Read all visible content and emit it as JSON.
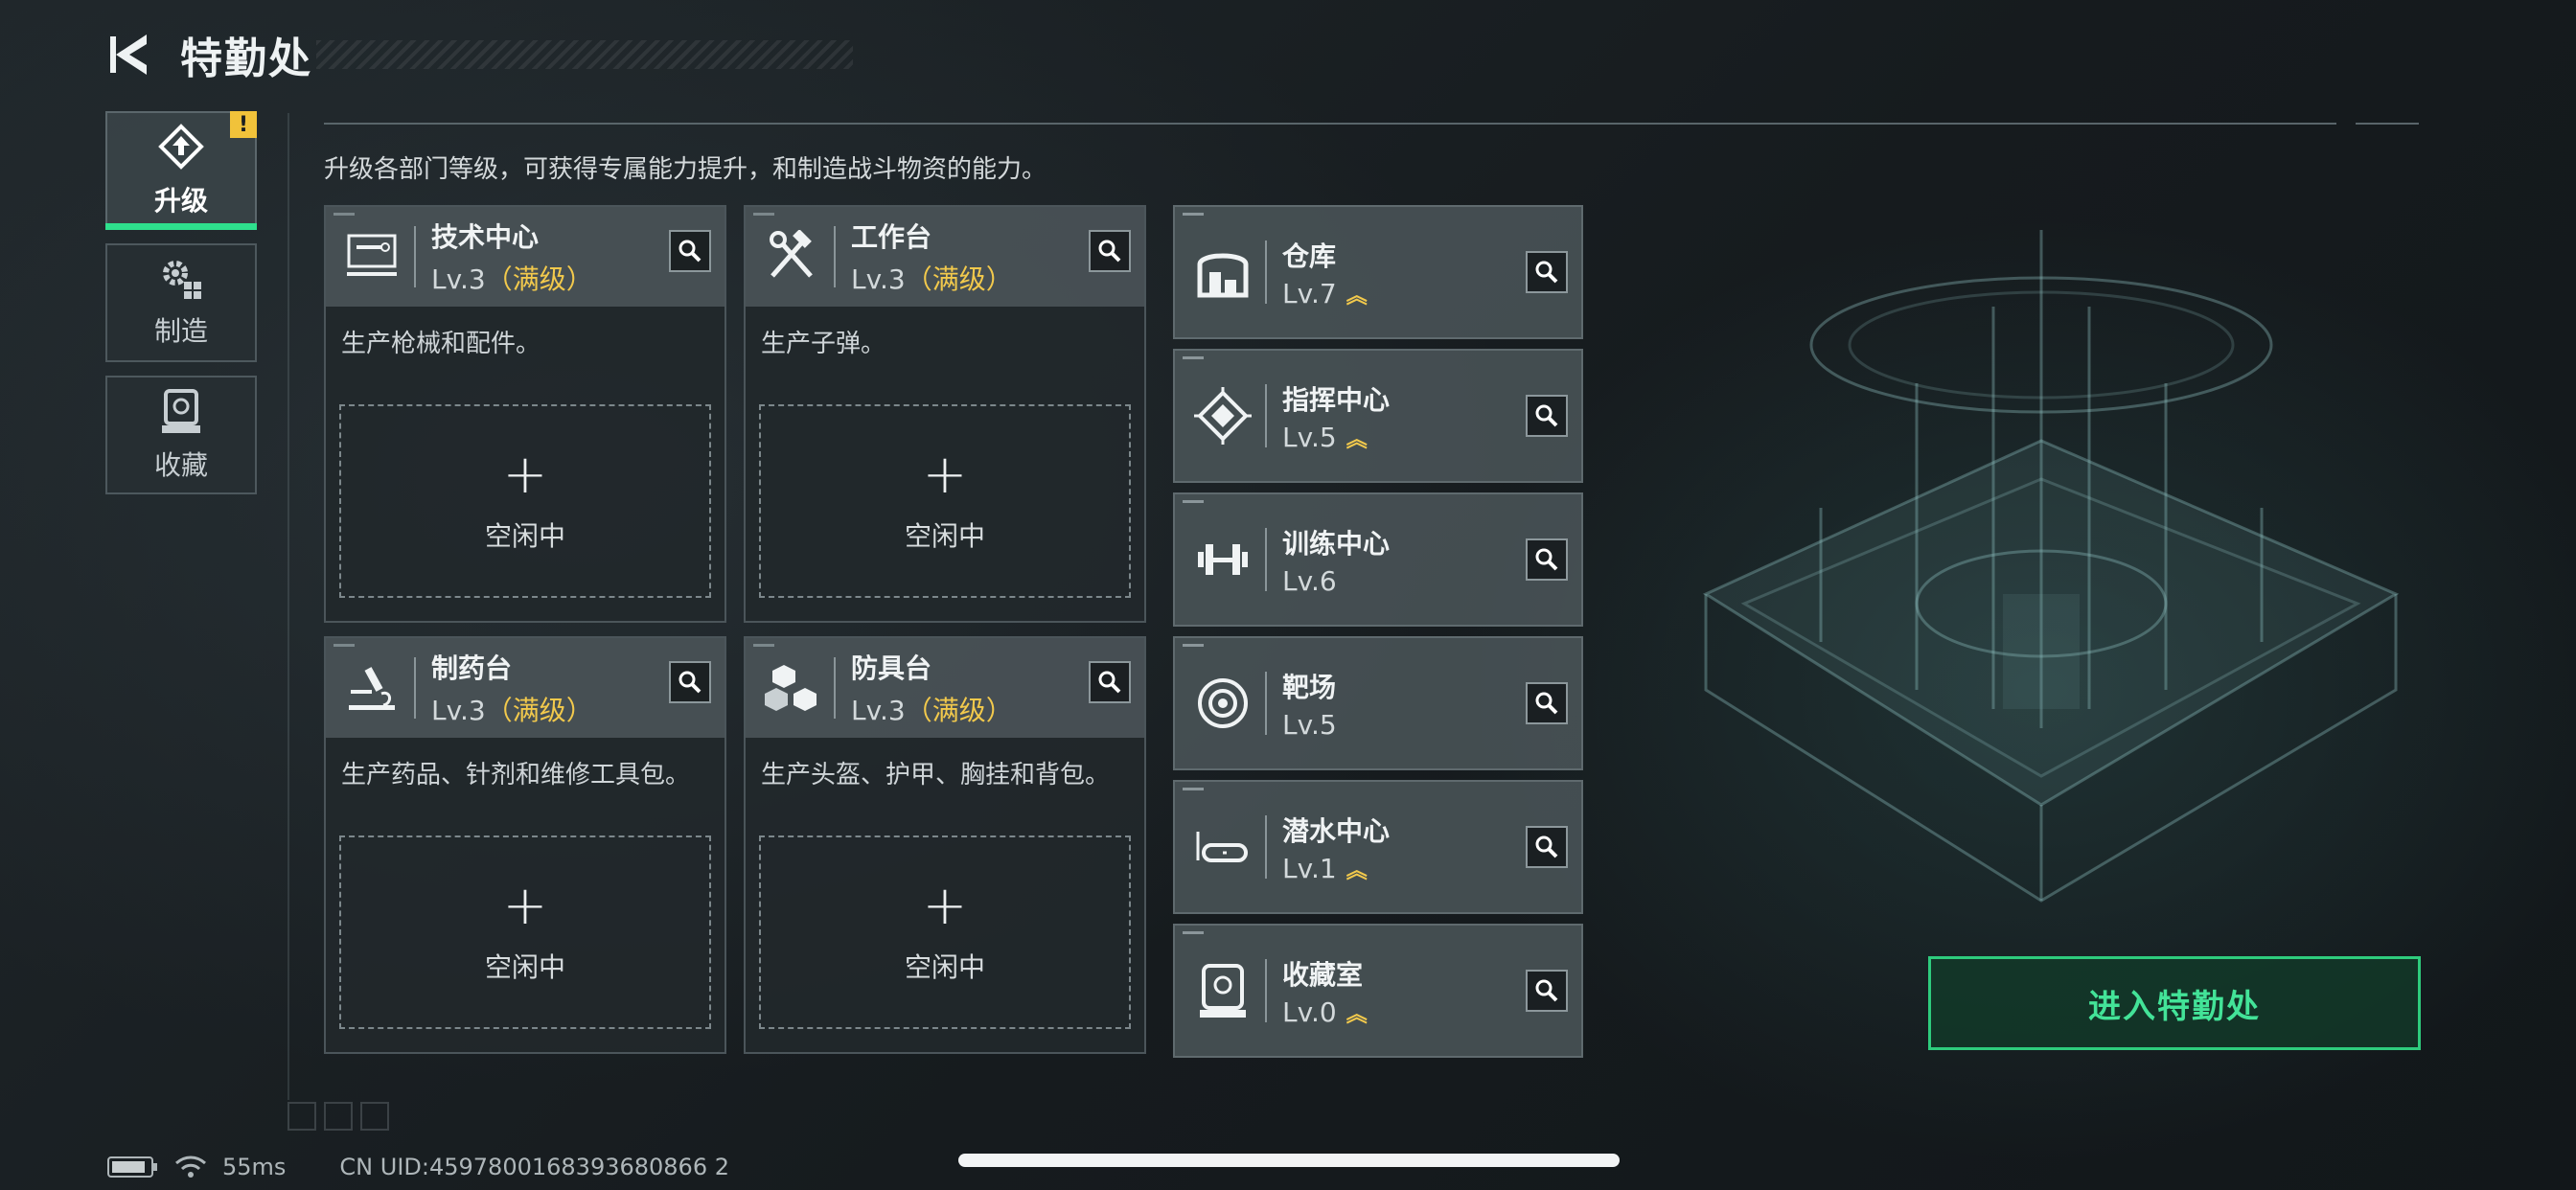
{
  "header": {
    "title": "特勤处"
  },
  "subtitle": "升级各部门等级，可获得专属能力提升，和制造战斗物资的能力。",
  "sidenav": {
    "items": [
      {
        "label": "升级",
        "icon": "upgrade-icon",
        "active": true,
        "badge": "!"
      },
      {
        "label": "制造",
        "icon": "gears-icon",
        "active": false
      },
      {
        "label": "收藏",
        "icon": "collection-icon",
        "active": false
      }
    ]
  },
  "workstations": [
    {
      "name": "技术中心",
      "level": "Lv.3",
      "status": "（满级）",
      "description": "生产枪械和配件。",
      "slot_plus": "+",
      "slot_text": "空闲中",
      "icon": "monitor-icon"
    },
    {
      "name": "工作台",
      "level": "Lv.3",
      "status": "（满级）",
      "description": "生产子弹。",
      "slot_plus": "+",
      "slot_text": "空闲中",
      "icon": "hammer-wrench-icon"
    },
    {
      "name": "制药台",
      "level": "Lv.3",
      "status": "（满级）",
      "description": "生产药品、针剂和维修工具包。",
      "slot_plus": "+",
      "slot_text": "空闲中",
      "icon": "microscope-icon"
    },
    {
      "name": "防具台",
      "level": "Lv.3",
      "status": "（满级）",
      "description": "生产头盔、护甲、胸挂和背包。",
      "slot_plus": "+",
      "slot_text": "空闲中",
      "icon": "cubes-icon"
    }
  ],
  "facilities": [
    {
      "name": "仓库",
      "level": "Lv.7",
      "upgradable": true,
      "icon": "warehouse-icon"
    },
    {
      "name": "指挥中心",
      "level": "Lv.5",
      "upgradable": true,
      "icon": "chip-icon"
    },
    {
      "name": "训练中心",
      "level": "Lv.6",
      "upgradable": false,
      "icon": "dumbbell-icon"
    },
    {
      "name": "靶场",
      "level": "Lv.5",
      "upgradable": false,
      "icon": "target-icon"
    },
    {
      "name": "潜水中心",
      "level": "Lv.1",
      "upgradable": true,
      "icon": "diving-mask-icon"
    },
    {
      "name": "收藏室",
      "level": "Lv.0",
      "upgradable": true,
      "icon": "trophy-case-icon"
    }
  ],
  "enter_button": "进入特勤处",
  "status": {
    "ping": "55ms",
    "uid": "CN UID:4597800168393680866 2"
  },
  "colors": {
    "accent_green": "#2ee08d",
    "maxed_gold": "#f2c94c",
    "alert_yellow": "#f1c23a"
  }
}
